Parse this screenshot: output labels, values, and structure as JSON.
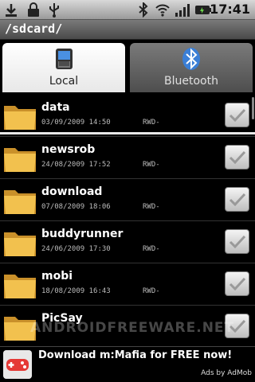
{
  "status_bar": {
    "time": "17:41",
    "icons": [
      "download-icon",
      "lock-icon",
      "usb-icon",
      "bluetooth-icon",
      "wifi-icon",
      "signal-icon",
      "battery-icon"
    ]
  },
  "path": {
    "title": "/sdcard/"
  },
  "tabs": [
    {
      "label": "Local",
      "icon": "phone-icon",
      "active": true
    },
    {
      "label": "Bluetooth",
      "icon": "bluetooth-icon",
      "active": false
    }
  ],
  "files": [
    {
      "name": "data",
      "date": "03/09/2009 14:50",
      "perm": "RWD-",
      "checked": false
    },
    {
      "name": "newsrob",
      "date": "24/08/2009 17:52",
      "perm": "RWD-",
      "checked": false
    },
    {
      "name": "download",
      "date": "07/08/2009 18:06",
      "perm": "RWD-",
      "checked": false
    },
    {
      "name": "buddyrunner",
      "date": "24/06/2009 17:30",
      "perm": "RWD-",
      "checked": false
    },
    {
      "name": "mobi",
      "date": "18/08/2009 16:43",
      "perm": "RWD-",
      "checked": false
    },
    {
      "name": "PicSay",
      "date": "",
      "perm": "",
      "checked": false
    }
  ],
  "watermark": "ANDROIDFREEWARE.NET",
  "ad": {
    "text": "Download m:Mafia for FREE now!",
    "credit": "Ads by AdMob",
    "icon": "gamepad-icon"
  },
  "colors": {
    "folder": "#f2c14e",
    "folder_dark": "#c9902a",
    "ad_icon": "#e53935"
  }
}
